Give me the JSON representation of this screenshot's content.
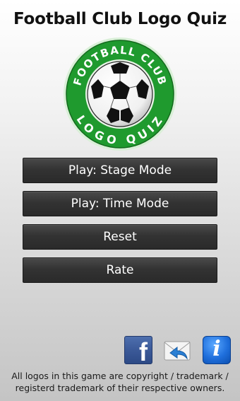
{
  "app": {
    "title": "Football Club Logo Quiz"
  },
  "logo": {
    "top_text": "FOOTBALL CLUB",
    "bottom_text": "LOGO QUIZ",
    "ring_color": "#1f9a2e",
    "inner_color": "#ffffff"
  },
  "menu": {
    "items": [
      {
        "label": "Play: Stage Mode"
      },
      {
        "label": "Play: Time Mode"
      },
      {
        "label": "Reset"
      },
      {
        "label": "Rate"
      }
    ]
  },
  "bottom_icons": {
    "facebook": {
      "icon": "facebook-icon",
      "glyph": "f",
      "color": "#3b5998"
    },
    "mail": {
      "icon": "mail-reply-icon",
      "color": "#2a7fd4"
    },
    "info": {
      "icon": "info-icon",
      "glyph": "i",
      "color": "#1f6fdc"
    }
  },
  "footer": {
    "line1": "All logos in this game are copyright / trademark /",
    "line2": "registerd trademark of their respective owners."
  }
}
